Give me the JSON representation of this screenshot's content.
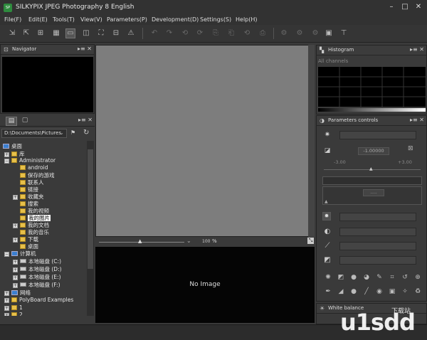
{
  "app": {
    "title": "SILKYPIX JPEG Photography 8 English",
    "logo_text": "SP"
  },
  "menu": [
    "File(F)",
    "Edit(E)",
    "Tools(T)",
    "View(V)",
    "Parameters(P)",
    "Development(D)",
    "Settings(S)",
    "Help(H)"
  ],
  "navigator": {
    "title": "Navigator"
  },
  "browser": {
    "path": "D:\\Documents\\Pictures"
  },
  "tree": [
    {
      "label": "桌面",
      "type": "pc"
    },
    {
      "label": "库",
      "type": "folder"
    },
    {
      "label": "Administrator",
      "type": "folder"
    },
    {
      "label": "android",
      "type": "folder"
    },
    {
      "label": "保存的游戏",
      "type": "folder"
    },
    {
      "label": "联系人",
      "type": "folder"
    },
    {
      "label": "链接",
      "type": "folder"
    },
    {
      "label": "收藏夹",
      "type": "folder"
    },
    {
      "label": "搜索",
      "type": "folder"
    },
    {
      "label": "我的视频",
      "type": "folder"
    },
    {
      "label": "我的图片",
      "type": "folder",
      "selected": true
    },
    {
      "label": "我的文档",
      "type": "folder"
    },
    {
      "label": "我的音乐",
      "type": "folder"
    },
    {
      "label": "下载",
      "type": "folder"
    },
    {
      "label": "桌面",
      "type": "folder"
    },
    {
      "label": "计算机",
      "type": "pc"
    },
    {
      "label": "本地磁盘 (C:)",
      "type": "drive"
    },
    {
      "label": "本地磁盘 (D:)",
      "type": "drive"
    },
    {
      "label": "本地磁盘 (E:)",
      "type": "drive"
    },
    {
      "label": "本地磁盘 (F:)",
      "type": "drive"
    },
    {
      "label": "网络",
      "type": "pc"
    },
    {
      "label": "PolyBoard Examples",
      "type": "folder"
    },
    {
      "label": "1",
      "type": "folder"
    },
    {
      "label": "2",
      "type": "folder"
    }
  ],
  "viewer": {
    "zoom": "100",
    "zoom_unit": "%",
    "no_image": "No Image"
  },
  "histogram": {
    "title": "Histogram",
    "channel": "All channels"
  },
  "params": {
    "title": "Parameters controls",
    "exposure_value": "-1.00000",
    "range_min": "-3.00",
    "range_max": "+3.00",
    "dots": "....."
  },
  "white_balance": {
    "title": "White balance"
  },
  "watermark": {
    "text": "u1sdd",
    "sub": "下载站"
  }
}
